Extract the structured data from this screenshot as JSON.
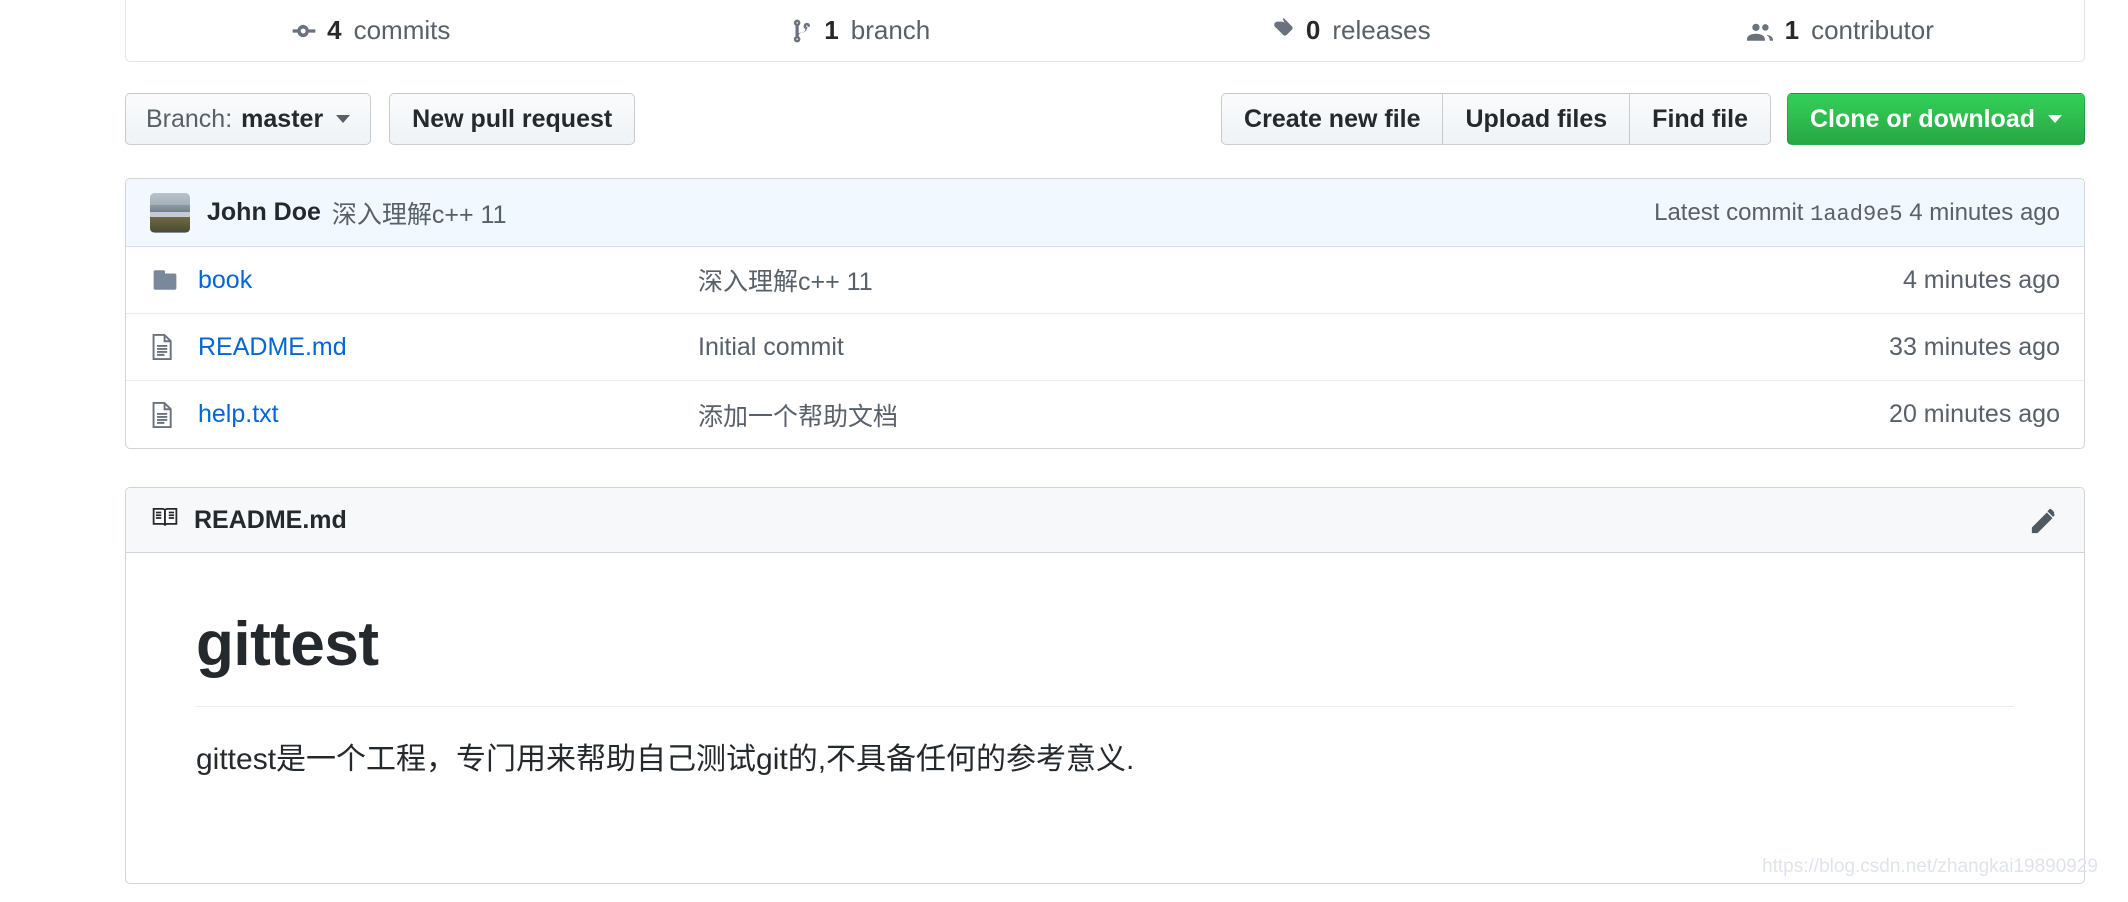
{
  "stats": [
    {
      "icon": "commit-icon",
      "num": "4",
      "label": "commits"
    },
    {
      "icon": "branch-icon",
      "num": "1",
      "label": "branch"
    },
    {
      "icon": "tag-icon",
      "num": "0",
      "label": "releases"
    },
    {
      "icon": "contributors-icon",
      "num": "1",
      "label": "contributor"
    }
  ],
  "toolbar": {
    "branch_prefix": "Branch: ",
    "branch_name": "master",
    "new_pull_request": "New pull request",
    "create_new_file": "Create new file",
    "upload_files": "Upload files",
    "find_file": "Find file",
    "clone_or_download": "Clone or download"
  },
  "latest_commit": {
    "author": "John Doe",
    "message": "深入理解c++ 11",
    "prefix": "Latest commit ",
    "sha": "1aad9e5",
    "age": " 4 minutes ago"
  },
  "files": [
    {
      "type": "directory",
      "icon": "folder-icon",
      "name": "book",
      "message": "深入理解c++ 11",
      "age": "4 minutes ago"
    },
    {
      "type": "file",
      "icon": "file-icon",
      "name": "README.md",
      "message": "Initial commit",
      "age": "33 minutes ago"
    },
    {
      "type": "file",
      "icon": "file-icon",
      "name": "help.txt",
      "message": "添加一个帮助文档",
      "age": "20 minutes ago"
    }
  ],
  "readme": {
    "icon": "book-icon",
    "title": "README.md",
    "edit_icon": "pencil-icon",
    "heading": "gittest",
    "paragraph": "gittest是一个工程，专门用来帮助自己测试git的,不具备任何的参考意义."
  },
  "watermark": "https://blog.csdn.net/zhangkai19890929",
  "colors": {
    "link": "#0366d6",
    "muted": "#586069",
    "green": "#28a745",
    "commit_bg": "#f1f8ff",
    "panel_head": "#f6f8fa",
    "border": "#d1d5da"
  }
}
